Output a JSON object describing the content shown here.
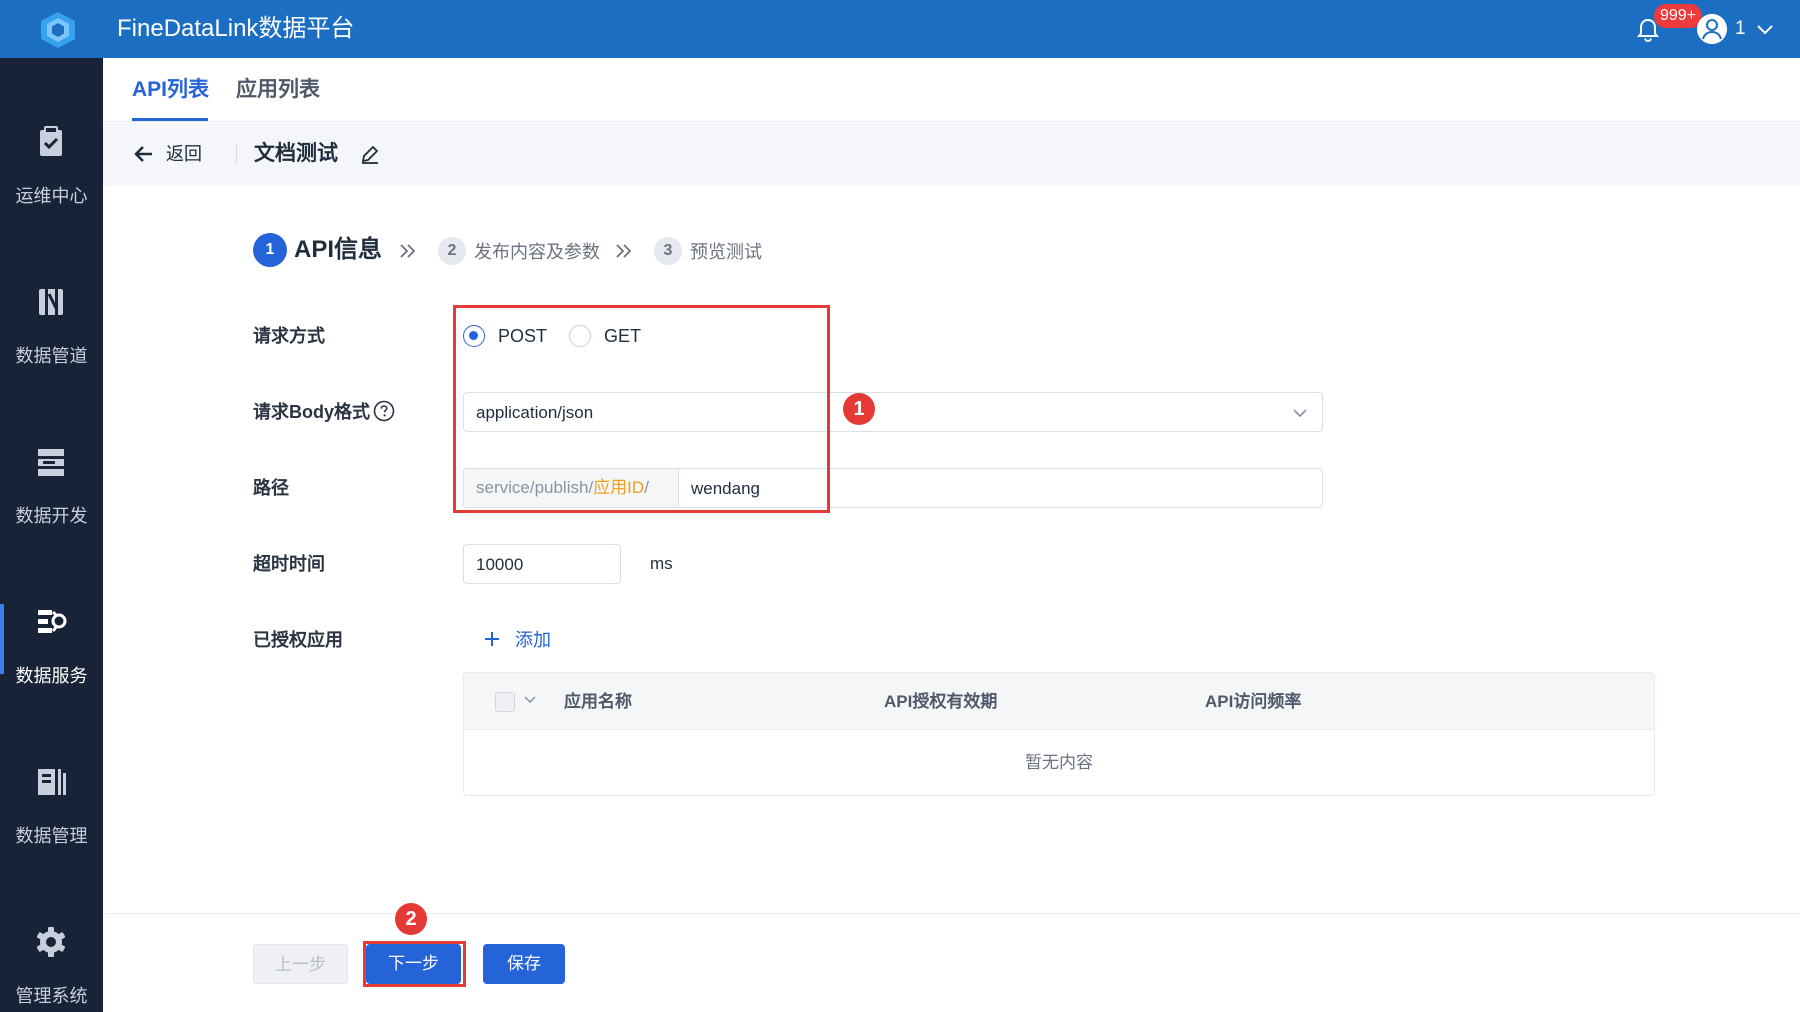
{
  "colors": {
    "topbar": "#1b6ec2",
    "sidebar": "#182338",
    "accent": "#2563d9",
    "highlight_orange": "#f0a020",
    "annotation_red": "#e53935"
  },
  "header": {
    "app_title": "FineDataLink数据平台",
    "notification_badge": "999+",
    "user_name": "1"
  },
  "sidebar": {
    "items": [
      {
        "label": "运维中心",
        "icon": "clipboard-check-icon"
      },
      {
        "label": "数据管道",
        "icon": "pipeline-icon"
      },
      {
        "label": "数据开发",
        "icon": "database-dev-icon"
      },
      {
        "label": "数据服务",
        "icon": "data-service-icon",
        "active": true
      },
      {
        "label": "数据管理",
        "icon": "data-management-icon"
      },
      {
        "label": "管理系统",
        "icon": "gear-icon"
      }
    ]
  },
  "tabs": [
    {
      "label": "API列表",
      "active": true
    },
    {
      "label": "应用列表"
    }
  ],
  "subheader": {
    "back_label": "返回",
    "title": "文档测试"
  },
  "steps": [
    {
      "num": "1",
      "label": "API信息",
      "active": true
    },
    {
      "num": "2",
      "label": "发布内容及参数"
    },
    {
      "num": "3",
      "label": "预览测试"
    }
  ],
  "form": {
    "method_label": "请求方式",
    "method_options": [
      "POST",
      "GET"
    ],
    "method_selected": "POST",
    "body_format_label": "请求Body格式",
    "body_format_value": "application/json",
    "path_label": "路径",
    "path_prefix": "service/publish",
    "path_app_id": "应用ID",
    "path_sep": "/",
    "path_value": "wendang",
    "timeout_label": "超时时间",
    "timeout_value": "10000",
    "timeout_unit": "ms",
    "authorized_label": "已授权应用",
    "add_label": "添加"
  },
  "table": {
    "columns": [
      "应用名称",
      "API授权有效期",
      "API访问频率"
    ],
    "rows": [],
    "empty_text": "暂无内容"
  },
  "annotations": [
    "1",
    "2"
  ],
  "footer": {
    "prev_label": "上一步",
    "next_label": "下一步",
    "save_label": "保存"
  }
}
